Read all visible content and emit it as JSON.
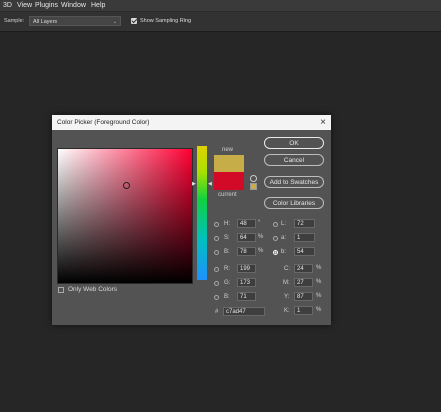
{
  "menubar": {
    "items": [
      "3D",
      "View",
      "Plugins",
      "Window",
      "Help"
    ]
  },
  "options": {
    "sample_label": "Sample:",
    "sample_value": "All Layers",
    "show_ring_label": "Show Sampling Ring"
  },
  "dialog": {
    "title": "Color Picker (Foreground Color)",
    "new_label": "new",
    "current_label": "current",
    "buttons": {
      "ok": "OK",
      "cancel": "Cancel",
      "add_swatches": "Add to Swatches",
      "color_libraries": "Color Libraries"
    },
    "hsb": {
      "h_label": "H:",
      "h": "48",
      "h_unit": "°",
      "s_label": "S:",
      "s": "64",
      "s_unit": "%",
      "b_label": "B:",
      "b": "78",
      "b_unit": "%"
    },
    "rgb": {
      "r_label": "R:",
      "r": "199",
      "g_label": "G:",
      "g": "173",
      "b_label": "B:",
      "b": "71"
    },
    "lab": {
      "l_label": "L:",
      "l": "72",
      "a_label": "a:",
      "a": "1",
      "b_label": "b:",
      "b": "54"
    },
    "cmyk": {
      "c_label": "C:",
      "c": "24",
      "m_label": "M:",
      "m": "27",
      "y_label": "Y:",
      "y": "87",
      "k_label": "K:",
      "k": "1",
      "unit": "%"
    },
    "hex_label": "#",
    "hex": "c7ad47",
    "only_web": "Only Web Colors"
  },
  "colors": {
    "new": "#c7ad47",
    "current": "#d20a28"
  }
}
